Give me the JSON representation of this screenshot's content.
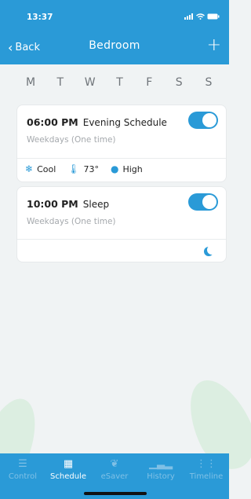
{
  "status_bar": {
    "time": "13:37"
  },
  "header": {
    "back_label": "Back",
    "title": "Bedroom",
    "add_label": "+"
  },
  "days": [
    "M",
    "T",
    "W",
    "T",
    "F",
    "S",
    "S"
  ],
  "schedules": [
    {
      "time": "06:00 PM",
      "name": "Evening Schedule",
      "repeat": "Weekdays (One time)",
      "enabled": true,
      "mode": "Cool",
      "temperature": "73°",
      "fan": "High"
    },
    {
      "time": "10:00 PM",
      "name": "Sleep",
      "repeat": "Weekdays (One time)",
      "enabled": true,
      "icon": "moon-icon"
    }
  ],
  "tabs": [
    {
      "label": "Control",
      "icon": "sliders-icon",
      "active": false
    },
    {
      "label": "Schedule",
      "icon": "calendar-icon",
      "active": true
    },
    {
      "label": "eSaver",
      "icon": "leaf-icon",
      "active": false
    },
    {
      "label": "History",
      "icon": "bar-chart-icon",
      "active": false
    },
    {
      "label": "Timeline",
      "icon": "timeline-icon",
      "active": false
    }
  ],
  "colors": {
    "accent": "#2a9ad7",
    "background": "#f0f3f4"
  }
}
